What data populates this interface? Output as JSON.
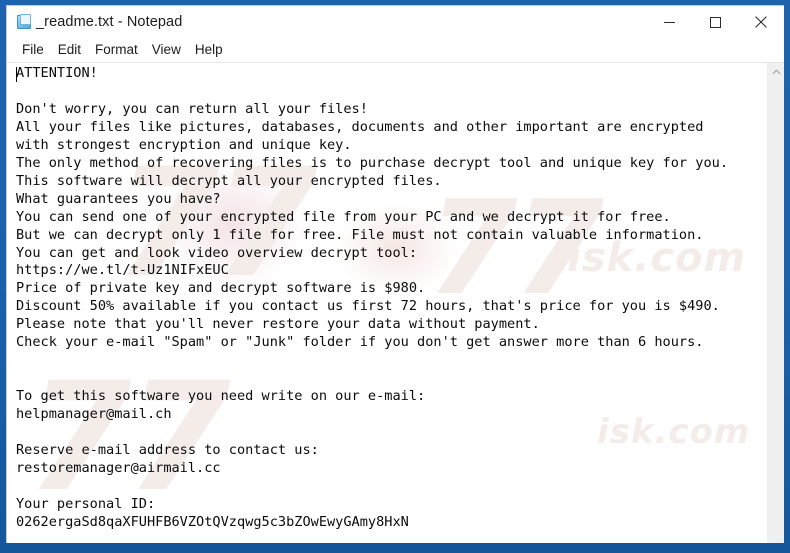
{
  "window": {
    "title": "_readme.txt - Notepad",
    "icon": "notepad-document-icon",
    "frame_color": "#1a61aa",
    "background_color": "#ffffff",
    "controls": {
      "minimize": "minimize-icon",
      "maximize": "maximize-icon",
      "close": "close-icon"
    }
  },
  "menu": {
    "items": [
      {
        "label": "File"
      },
      {
        "label": "Edit"
      },
      {
        "label": "Format"
      },
      {
        "label": "View"
      },
      {
        "label": "Help"
      }
    ]
  },
  "document": {
    "filename": "_readme.txt",
    "body": "ATTENTION!\n\nDon't worry, you can return all your files!\nAll your files like pictures, databases, documents and other important are encrypted\nwith strongest encryption and unique key.\nThe only method of recovering files is to purchase decrypt tool and unique key for you.\nThis software will decrypt all your encrypted files.\nWhat guarantees you have?\nYou can send one of your encrypted file from your PC and we decrypt it for free.\nBut we can decrypt only 1 file for free. File must not contain valuable information.\nYou can get and look video overview decrypt tool:\nhttps://we.tl/t-Uz1NIFxEUC\nPrice of private key and decrypt software is $980.\nDiscount 50% available if you contact us first 72 hours, that's price for you is $490.\nPlease note that you'll never restore your data without payment.\nCheck your e-mail \"Spam\" or \"Junk\" folder if you don't get answer more than 6 hours.\n\n\nTo get this software you need write on our e-mail:\nhelpmanager@mail.ch\n\nReserve e-mail address to contact us:\nrestoremanager@airmail.cc\n\nYour personal ID:\n0262ergaSd8qaXFUHFB6VZOtQVzqwg5c3bZOwEwyGAmy8HxN",
    "details": {
      "heading": "ATTENTION!",
      "video_url": "https://we.tl/t-Uz1NIFxEUC",
      "price_full": "$980",
      "price_discount": "$490",
      "discount_percent": "50%",
      "discount_window_hours": "72 hours",
      "response_time": "6 hours",
      "free_decrypt_count": "1 file",
      "primary_email": "helpmanager@mail.ch",
      "reserve_email": "restoremanager@airmail.cc",
      "personal_id": "0262ergaSd8qaXFUHFB6VZOtQVzqwg5c3bZOwEwyGAmy8HxN"
    }
  },
  "watermark": {
    "mark_1": "77",
    "mark_2": "77",
    "mark_3": "77",
    "text_1": "isk.com",
    "text_2": "isk.com"
  },
  "scrollbar": {
    "up_arrow": "chevron-up-icon",
    "down_arrow": "chevron-down-icon"
  }
}
